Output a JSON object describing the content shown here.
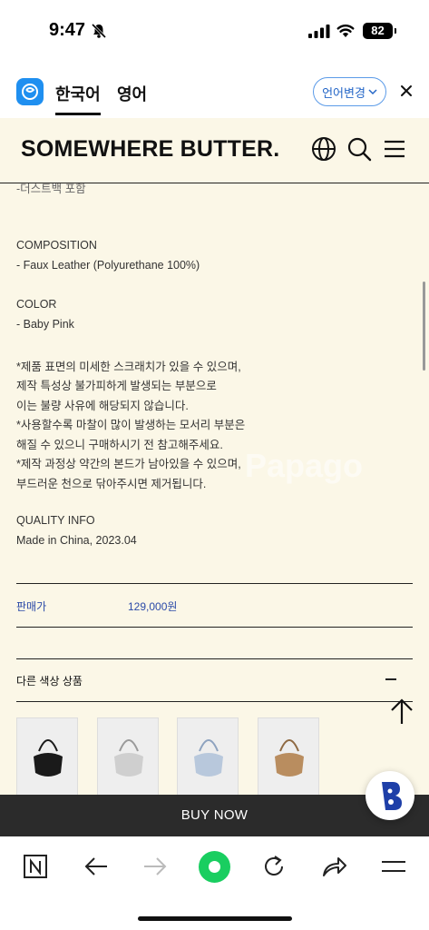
{
  "status_bar": {
    "time": "9:47",
    "battery": "82"
  },
  "translate_bar": {
    "tabs": [
      "한국어",
      "영어"
    ],
    "lang_change_label": "언어변경"
  },
  "site": {
    "logo": "SOMEWHERE BUTTER.",
    "cut_off_line": "-더스트백 포함",
    "composition_title": "COMPOSITION",
    "composition_value": "- Faux Leather (Polyurethane 100%)",
    "color_title": "COLOR",
    "color_value": "- Baby Pink",
    "notes": [
      "*제품 표면의 미세한 스크래치가 있을 수 있으며,",
      "제작 특성상 불가피하게 발생되는 부분으로",
      "이는 불량 사유에 해당되지 않습니다.",
      "*사용할수록 마찰이 많이 발생하는 모서리 부분은",
      "해질 수 있으니 구매하시기 전 참고해주세요.",
      "*제작 과정상 약간의 본드가 남아있을 수 있으며,",
      "부드러운 천으로 닦아주시면 제거됩니다."
    ],
    "quality_title": "QUALITY INFO",
    "quality_value": "Made in China, 2023.04",
    "watermark": "Papago",
    "price_label": "판매가",
    "price_value": "129,000원",
    "other_colors_label": "다른 색상 상품",
    "thumbnails": [
      {
        "name": "black-bag",
        "color": "#1a1a1a"
      },
      {
        "name": "silver-bag",
        "color": "#cfcfcf"
      },
      {
        "name": "blue-bag",
        "color": "#b8c8dc"
      },
      {
        "name": "tan-bag",
        "color": "#b98d5f"
      }
    ]
  },
  "buy_now_label": "BUY NOW"
}
